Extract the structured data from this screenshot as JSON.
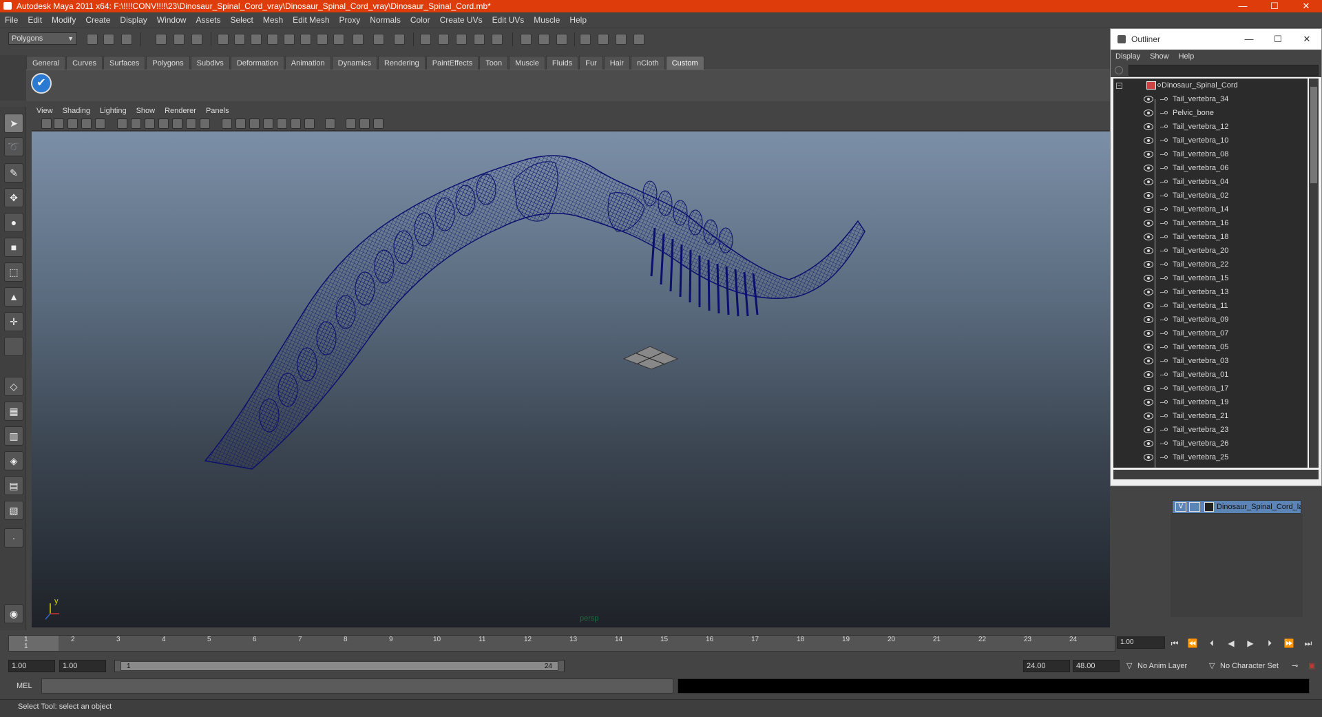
{
  "window": {
    "title": "Autodesk Maya 2011 x64: F:\\!!!!CONV!!!!\\23\\Dinosaur_Spinal_Cord_vray\\Dinosaur_Spinal_Cord_vray\\Dinosaur_Spinal_Cord.mb*",
    "minimize": "—",
    "maximize": "☐",
    "close": "✕"
  },
  "menubar": [
    "File",
    "Edit",
    "Modify",
    "Create",
    "Display",
    "Window",
    "Assets",
    "Select",
    "Mesh",
    "Edit Mesh",
    "Proxy",
    "Normals",
    "Color",
    "Create UVs",
    "Edit UVs",
    "Muscle",
    "Help"
  ],
  "mode_selector": "Polygons",
  "shelf_tabs": [
    "General",
    "Curves",
    "Surfaces",
    "Polygons",
    "Subdivs",
    "Deformation",
    "Animation",
    "Dynamics",
    "Rendering",
    "PaintEffects",
    "Toon",
    "Muscle",
    "Fluids",
    "Fur",
    "Hair",
    "nCloth",
    "Custom"
  ],
  "active_shelf": "Custom",
  "panel_menu": [
    "View",
    "Shading",
    "Lighting",
    "Show",
    "Renderer",
    "Panels"
  ],
  "viewport": {
    "camera_label": "persp",
    "axis_y": "y"
  },
  "timeline": {
    "ticks": [
      "1",
      "2",
      "3",
      "4",
      "5",
      "6",
      "7",
      "8",
      "9",
      "10",
      "11",
      "12",
      "13",
      "14",
      "15",
      "16",
      "17",
      "18",
      "19",
      "20",
      "21",
      "22",
      "23",
      "24"
    ],
    "current_marker": "1",
    "current_frame": "1.00"
  },
  "range": {
    "start_time": "1.00",
    "start_playback": "1.00",
    "slider_start": "1",
    "slider_end": "24",
    "end_playback": "24.00",
    "end_time": "48.00",
    "anim_layer": "No Anim Layer",
    "character_set": "No Character Set"
  },
  "command": {
    "label": "MEL"
  },
  "status": {
    "help_text": "Select Tool: select an object"
  },
  "outliner": {
    "title": "Outliner",
    "menu": [
      "Display",
      "Show",
      "Help"
    ],
    "root": "Dinosaur_Spinal_Cord",
    "items": [
      "Tail_vertebra_34",
      "Pelvic_bone",
      "Tail_vertebra_12",
      "Tail_vertebra_10",
      "Tail_vertebra_08",
      "Tail_vertebra_06",
      "Tail_vertebra_04",
      "Tail_vertebra_02",
      "Tail_vertebra_14",
      "Tail_vertebra_16",
      "Tail_vertebra_18",
      "Tail_vertebra_20",
      "Tail_vertebra_22",
      "Tail_vertebra_15",
      "Tail_vertebra_13",
      "Tail_vertebra_11",
      "Tail_vertebra_09",
      "Tail_vertebra_07",
      "Tail_vertebra_05",
      "Tail_vertebra_03",
      "Tail_vertebra_01",
      "Tail_vertebra_17",
      "Tail_vertebra_19",
      "Tail_vertebra_21",
      "Tail_vertebra_23",
      "Tail_vertebra_26",
      "Tail_vertebra_25"
    ]
  },
  "layer": {
    "visible": "V",
    "name": "Dinosaur_Spinal_Cord_la"
  },
  "colors": {
    "titlebar": "#de3c0b",
    "wireframe": "#0c0f6e",
    "layer_highlight": "#5c84b6"
  },
  "icons": [
    "select-arrow-icon",
    "lasso-icon",
    "paint-select-icon",
    "move-icon",
    "rotate-icon",
    "scale-icon",
    "manipulator-icon",
    "soft-mod-icon",
    "show-manipulator-icon",
    "layout-icon",
    "play-icon",
    "rewind-icon",
    "eye-icon"
  ]
}
